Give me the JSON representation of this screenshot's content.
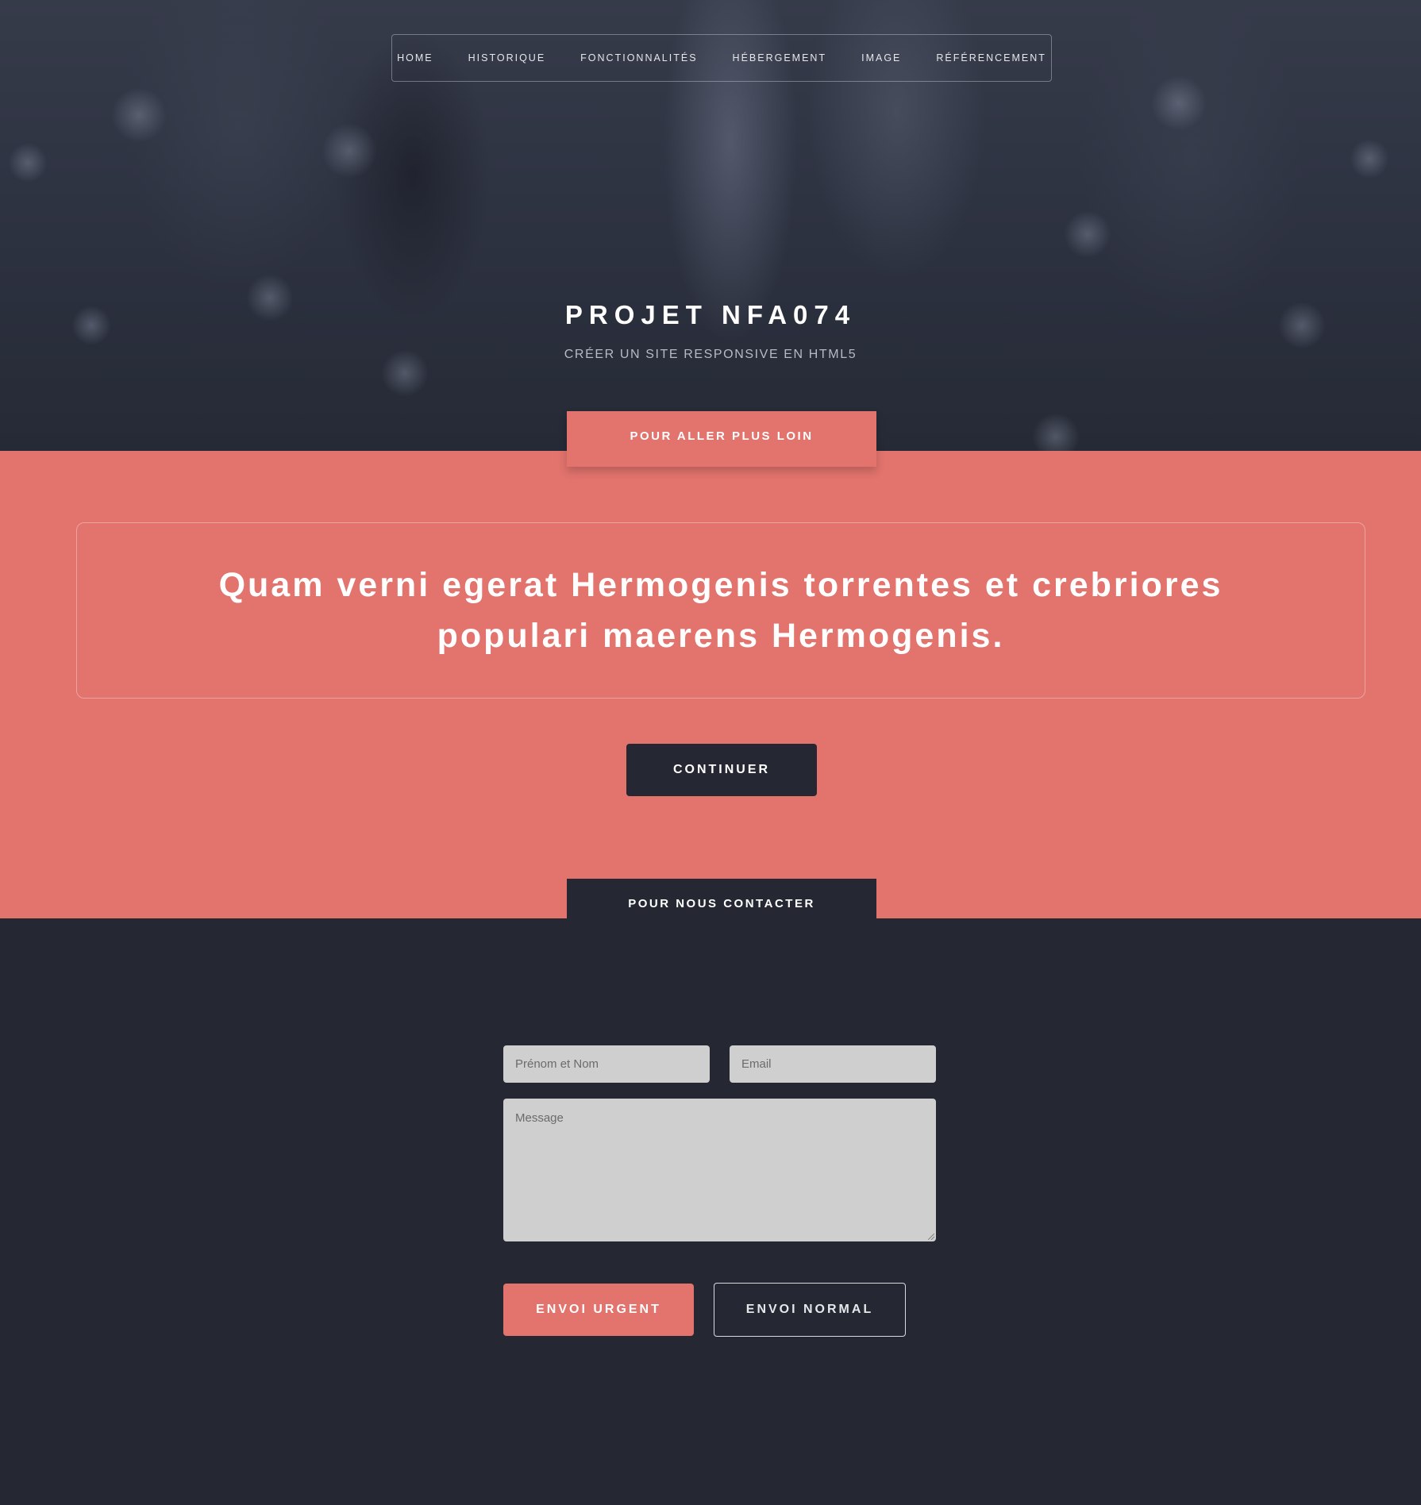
{
  "nav": {
    "items": [
      {
        "label": "HOME"
      },
      {
        "label": "HISTORIQUE"
      },
      {
        "label": "FONCTIONNALITÉS"
      },
      {
        "label": "HÉBERGEMENT"
      },
      {
        "label": "IMAGE"
      },
      {
        "label": "RÉFÉRENCEMENT"
      }
    ]
  },
  "hero": {
    "title": "PROJET NFA074",
    "subtitle": "CRÉER UN SITE RESPONSIVE EN HTML5"
  },
  "section_more": {
    "tab_label": "POUR ALLER PLUS LOIN",
    "quote": "Quam verni egerat Hermogenis torrentes et crebriores populari maerens Hermogenis.",
    "button_label": "CONTINUER"
  },
  "contact": {
    "tab_label": "POUR NOUS CONTACTER",
    "name_placeholder": "Prénom et Nom",
    "email_placeholder": "Email",
    "message_placeholder": "Message",
    "urgent_label": "ENVOI URGENT",
    "normal_label": "ENVOI NORMAL"
  },
  "colors": {
    "accent": "#e2736d",
    "dark": "#252832",
    "field_bg": "#cfcfcf"
  }
}
